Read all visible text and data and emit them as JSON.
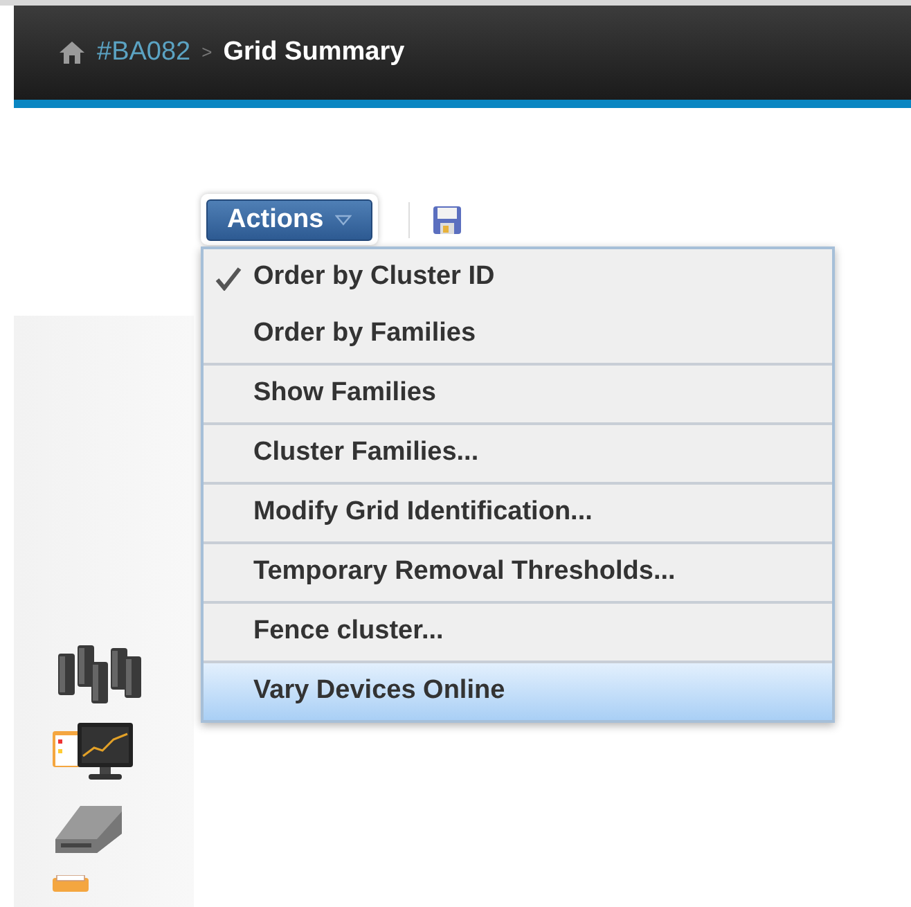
{
  "breadcrumb": {
    "link": "#BA082",
    "separator": ">",
    "current": "Grid Summary"
  },
  "toolbar": {
    "actions_button": "Actions"
  },
  "menu": {
    "groups": [
      [
        {
          "label": "Order by Cluster ID",
          "checked": true,
          "selected": false
        },
        {
          "label": "Order by Families",
          "checked": false,
          "selected": false
        }
      ],
      [
        {
          "label": "Show Families",
          "checked": false,
          "selected": false
        }
      ],
      [
        {
          "label": "Cluster Families...",
          "checked": false,
          "selected": false
        }
      ],
      [
        {
          "label": "Modify Grid Identification...",
          "checked": false,
          "selected": false
        }
      ],
      [
        {
          "label": "Temporary Removal Thresholds...",
          "checked": false,
          "selected": false
        }
      ],
      [
        {
          "label": "Fence cluster...",
          "checked": false,
          "selected": false
        }
      ],
      [
        {
          "label": "Vary Devices Online",
          "checked": false,
          "selected": true
        }
      ]
    ]
  }
}
